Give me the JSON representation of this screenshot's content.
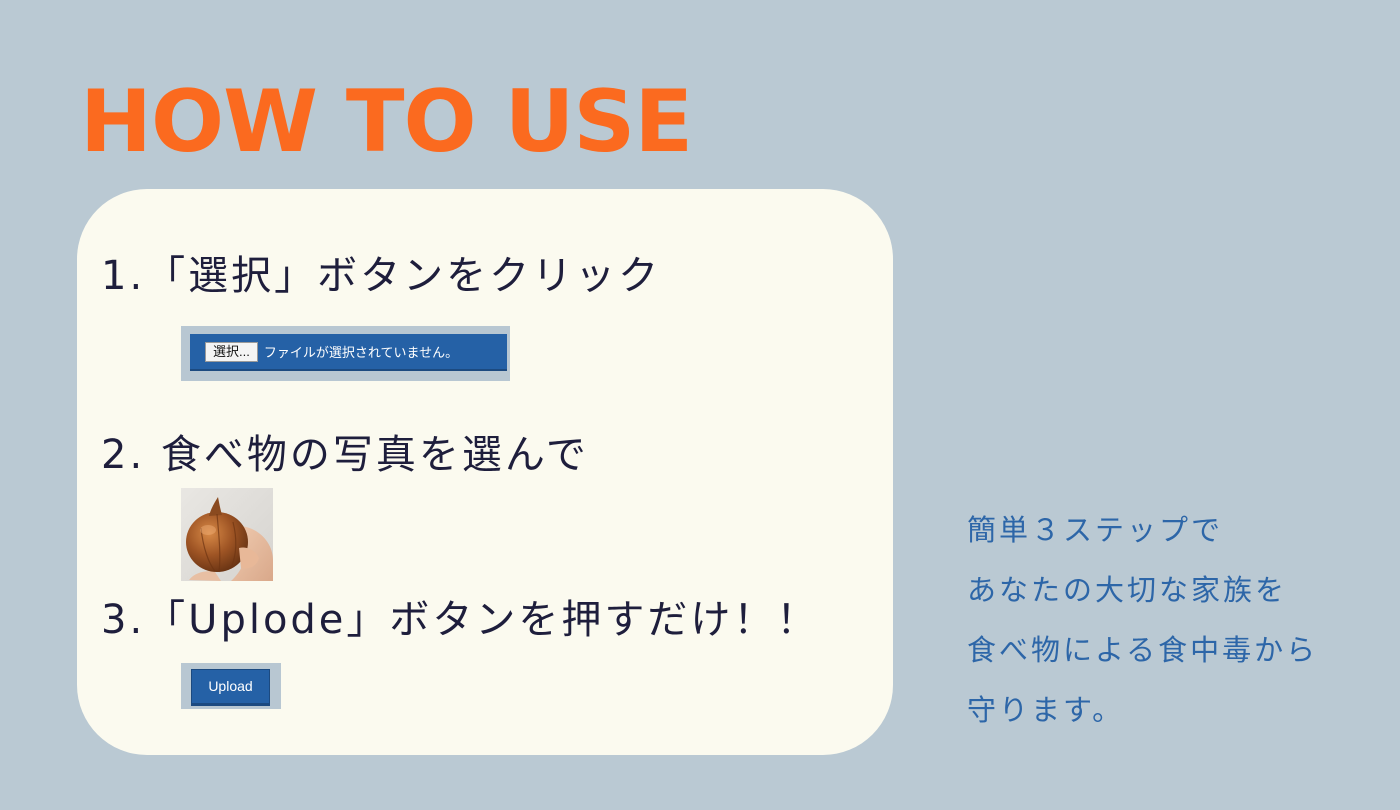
{
  "header": {
    "title": "HOW TO USE"
  },
  "steps": {
    "step1": "1.「選択」ボタンをクリック",
    "step2": "2. 食べ物の写真を選んで",
    "step3": "3.「Uplode」ボタンを押すだけ！！"
  },
  "file_input": {
    "button_label": "選択...",
    "status_text": "ファイルが選択されていません。"
  },
  "upload": {
    "button_label": "Upload"
  },
  "side_note": {
    "lines": [
      "簡単３ステップで",
      "あなたの大切な家族を",
      "食べ物による食中毒から",
      "守ります。"
    ]
  },
  "colors": {
    "background": "#bac9d3",
    "title": "#fb6a1f",
    "card": "#fbfaef",
    "step_text": "#1e1e3c",
    "button_blue": "#2561a6",
    "side_text": "#2d66a8"
  },
  "icons": {
    "photo": "onion-photo"
  }
}
